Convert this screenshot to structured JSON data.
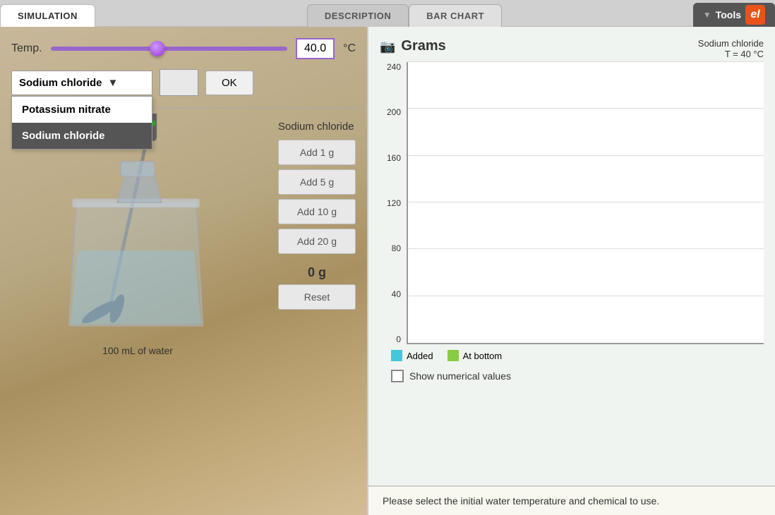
{
  "tabs": {
    "simulation": "SIMULATION",
    "description": "DESCRIPTION",
    "barchart": "BAR CHART",
    "tools": "Tools"
  },
  "simulation": {
    "temp_label": "Temp.",
    "temp_value": "40.0",
    "temp_unit": "°C",
    "ok_button": "OK",
    "selected_chemical": "Sodium chloride",
    "dropdown_options": [
      {
        "label": "Potassium nitrate",
        "selected": false
      },
      {
        "label": "Sodium chloride",
        "selected": true
      }
    ],
    "substance_label": "Sodium chloride",
    "add_buttons": [
      "Add 1 g",
      "Add 5 g",
      "Add 10 g",
      "Add 20 g"
    ],
    "amount_display": "0 g",
    "reset_button": "Reset",
    "beaker_label": "100 mL of water"
  },
  "chart": {
    "title": "Grams",
    "subtitle": "Sodium chloride",
    "temp_display": "T = 40 °C",
    "y_axis_labels": [
      "0",
      "40",
      "80",
      "120",
      "160",
      "200",
      "240"
    ],
    "legend": {
      "added_label": "Added",
      "at_bottom_label": "At bottom"
    },
    "show_values_label": "Show numerical values"
  },
  "description": {
    "text": "Please select the initial water temperature and chemical to use."
  },
  "icons": {
    "camera": "📷",
    "chevron": "▼",
    "dropdown_arrow": "▼"
  }
}
